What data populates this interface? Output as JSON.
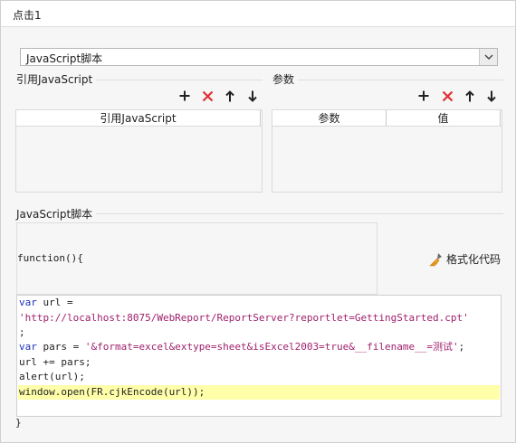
{
  "title": "点击1",
  "script_type_select": {
    "value": "JavaScript脚本"
  },
  "import_section": {
    "label": "引用JavaScript",
    "column_headers": [
      "引用JavaScript"
    ]
  },
  "params_section": {
    "label": "参数",
    "column_headers": [
      "参数",
      "值"
    ]
  },
  "script_section": {
    "label": "JavaScript脚本",
    "function_head": "function(){",
    "function_tail": "}",
    "format_button_label": "格式化代码"
  },
  "code": {
    "l1_kw": "var",
    "l1_rest": " url =",
    "l2_str": "'http://localhost:8075/WebReport/ReportServer?reportlet=GettingStarted.cpt'",
    "l3": ";",
    "l4_kw": "var",
    "l4_mid": " pars = ",
    "l4_str": "'&format=excel&extype=sheet&isExcel2003=true&__filename__=测试'",
    "l4_end": ";",
    "l5": "url += pars;",
    "l6": "alert(url);",
    "l7": "window.open(FR.cjkEncode(url));"
  },
  "icons": {
    "add": "plus-icon",
    "delete": "red-x-icon",
    "up": "arrow-up-icon",
    "down": "arrow-down-icon",
    "format": "broom-icon",
    "dropdown": "chevron-down-icon"
  },
  "colors": {
    "delete": "#e03030",
    "keyword": "#1a2fbf",
    "string": "#a0216d",
    "highlight": "#ffffaa"
  }
}
